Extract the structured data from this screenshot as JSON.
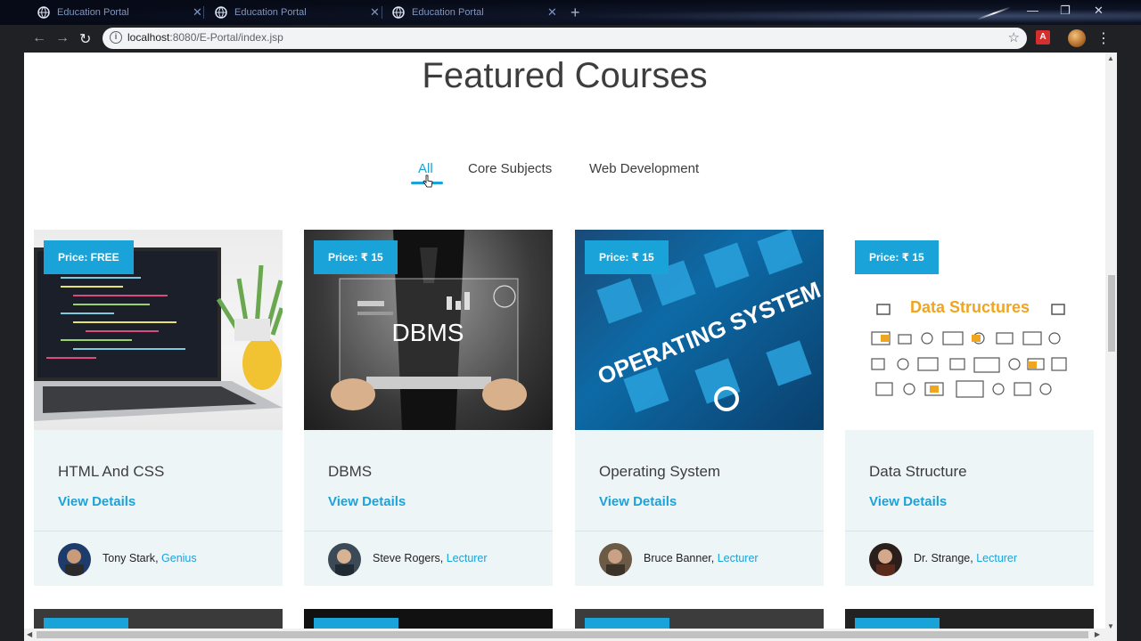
{
  "browser": {
    "tabs": [
      {
        "title": "Education Portal"
      },
      {
        "title": "Education Portal"
      },
      {
        "title": "Education Portal"
      }
    ],
    "url_host": "localhost",
    "url_rest": ":8080/E-Portal/index.jsp"
  },
  "page": {
    "title": "Featured Courses",
    "filters": [
      "All",
      "Core Subjects",
      "Web Development"
    ],
    "active_filter": "All"
  },
  "courses": [
    {
      "price": "Price: FREE",
      "title": "HTML And CSS",
      "view": "View Details",
      "instructor": "Tony Stark",
      "role": "Genius",
      "image": "laptop-code"
    },
    {
      "price": "Price: ₹ 15",
      "title": "DBMS",
      "view": "View Details",
      "instructor": "Steve Rogers",
      "role": "Lecturer",
      "image": "dbms-tablet",
      "image_text": "DBMS"
    },
    {
      "price": "Price: ₹ 15",
      "title": "Operating System",
      "view": "View Details",
      "instructor": "Bruce Banner",
      "role": "Lecturer",
      "image": "operating-system",
      "image_text": "OPERATING SYSTEM"
    },
    {
      "price": "Price: ₹ 15",
      "title": "Data Structure",
      "view": "View Details",
      "instructor": "Dr. Strange",
      "role": "Lecturer",
      "image": "data-structures",
      "image_text": "Data Structures"
    }
  ],
  "colors": {
    "accent": "#1aa3d9",
    "card_bg": "#eef5f7",
    "title": "#3d3d3d"
  }
}
